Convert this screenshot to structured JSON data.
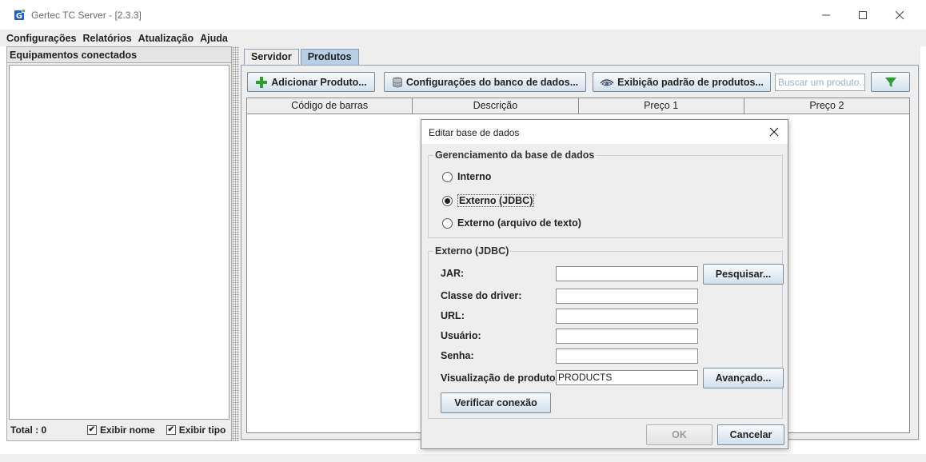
{
  "window": {
    "title": "Gertec TC Server - [2.3.3]"
  },
  "menu": [
    "Configurações",
    "Relatórios",
    "Atualização",
    "Ajuda"
  ],
  "left_panel": {
    "header": "Equipamentos conectados",
    "total": "Total : 0",
    "show_name": {
      "label": "Exibir nome",
      "checked": true
    },
    "show_type": {
      "label": "Exibir tipo",
      "checked": true
    }
  },
  "tabs": [
    {
      "label": "Servidor",
      "active": false
    },
    {
      "label": "Produtos",
      "active": true
    }
  ],
  "toolbar": {
    "add_product": "Adicionar Produto...",
    "db_config": "Configurações do banco de dados...",
    "default_view": "Exibição padrão de produtos...",
    "search_placeholder": "Buscar um produto..."
  },
  "table": {
    "columns": [
      "Código de barras",
      "Descrição",
      "Preço 1",
      "Preço 2"
    ],
    "rows": []
  },
  "dialog": {
    "title": "Editar base de dados",
    "management_group": {
      "legend": "Gerenciamento da base de dados",
      "options": [
        {
          "label": "Interno",
          "selected": false
        },
        {
          "label": "Externo (JDBC)",
          "selected": true
        },
        {
          "label": "Externo (arquivo de texto)",
          "selected": false
        }
      ]
    },
    "jdbc_group": {
      "legend": "Externo (JDBC)",
      "jar_label": "JAR:",
      "jar_value": "",
      "browse_button": "Pesquisar...",
      "driver_label": "Classe do driver:",
      "driver_value": "",
      "url_label": "URL:",
      "url_value": "",
      "user_label": "Usuário:",
      "user_value": "",
      "password_label": "Senha:",
      "password_value": "",
      "view_label": "Visualização de produto:",
      "view_value": "PRODUCTS",
      "advanced_button": "Avançado...",
      "test_button": "Verificar conexão"
    },
    "ok_button": "OK",
    "cancel_button": "Cancelar"
  },
  "colors": {
    "accent_tab": "#b8cfe5",
    "button_top": "#f8fbfd",
    "button_bottom": "#d3e0ec",
    "plus_icon": "#2e9e2e",
    "filter_icon": "#2e9e2e",
    "app_icon": "#1f5fbf"
  }
}
